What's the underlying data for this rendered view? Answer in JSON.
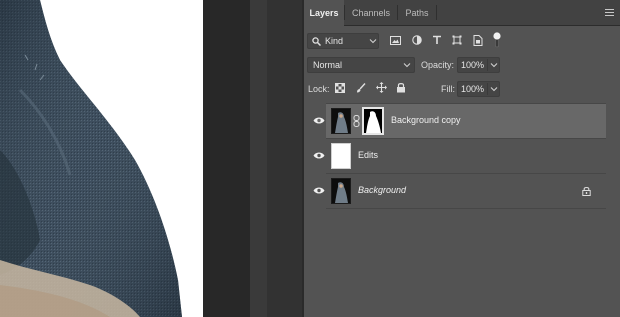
{
  "panel": {
    "tabs": [
      {
        "label": "Layers",
        "active": true
      },
      {
        "label": "Channels",
        "active": false
      },
      {
        "label": "Paths",
        "active": false
      }
    ],
    "filter": {
      "value": "Kind"
    },
    "blend_mode": {
      "value": "Normal"
    },
    "opacity": {
      "label": "Opacity:",
      "value": "100%"
    },
    "lock": {
      "label": "Lock:"
    },
    "fill": {
      "label": "Fill:",
      "value": "100%"
    },
    "layers": [
      {
        "name": "Background copy",
        "selected": true,
        "has_mask": true,
        "italic": false
      },
      {
        "name": "Edits",
        "selected": false,
        "has_mask": false,
        "italic": false
      },
      {
        "name": "Background",
        "selected": false,
        "has_mask": false,
        "italic": true,
        "locked": true
      }
    ]
  },
  "colors": {
    "panel_bg": "#535353",
    "tab_bar": "#424242",
    "selected_row": "#686868",
    "canvas": "#ffffff"
  },
  "icons": [
    "search-icon",
    "image-filter-icon",
    "adjustment-filter-icon",
    "type-filter-icon",
    "shape-filter-icon",
    "smart-object-filter-icon",
    "filter-toggle-icon",
    "panel-menu-icon",
    "lock-pixels-icon",
    "lock-paint-icon",
    "lock-move-icon",
    "lock-all-icon",
    "eye-icon",
    "link-icon",
    "lock-icon"
  ]
}
